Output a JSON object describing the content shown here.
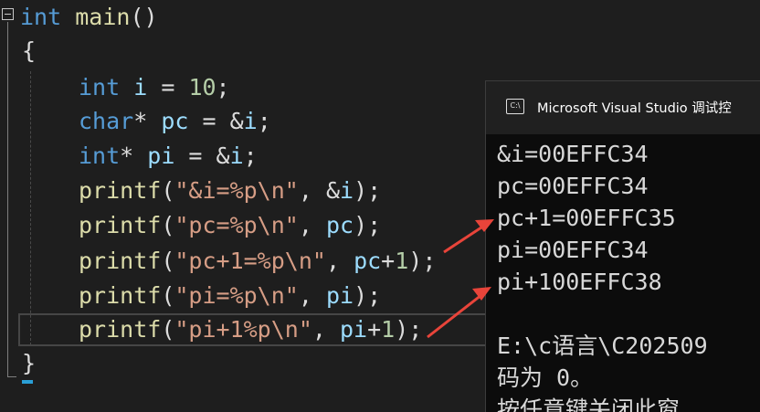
{
  "window_title": "Microsoft Visual Studio 调试控",
  "console_icon_label": "C:\\",
  "accent_color": "#e8443a",
  "code": {
    "line1": {
      "kw": "int",
      "fn": "main",
      "rest": "()"
    },
    "line2": "{",
    "line3": {
      "kw": "int",
      "var": "i",
      "op": " = ",
      "num": "10",
      "end": ";"
    },
    "line4": {
      "kw": "char",
      "mid": "* ",
      "var": "pc",
      "op": " = &",
      "var2": "i",
      "end": ";"
    },
    "line5": {
      "kw": "int",
      "mid": "* ",
      "var": "pi",
      "op": " = &",
      "var2": "i",
      "end": ";"
    },
    "line6": {
      "fn": "printf",
      "open": "(",
      "str": "\"&i=%p\\n\"",
      "sep": ", &",
      "var": "i",
      "close": ");"
    },
    "line7": {
      "fn": "printf",
      "open": "(",
      "str": "\"pc=%p\\n\"",
      "sep": ", ",
      "var": "pc",
      "close": ");"
    },
    "line8": {
      "fn": "printf",
      "open": "(",
      "str": "\"pc+1=%p\\n\"",
      "sep": ", ",
      "var": "pc",
      "plus": "+",
      "num": "1",
      "close": ");"
    },
    "line9": {
      "fn": "printf",
      "open": "(",
      "str": "\"pi=%p\\n\"",
      "sep": ", ",
      "var": "pi",
      "close": ");"
    },
    "line10": {
      "fn": "printf",
      "open": "(",
      "str": "\"pi+1%p\\n\"",
      "sep": ", ",
      "var": "pi",
      "plus": "+",
      "num": "1",
      "close": ");"
    },
    "line11": "}"
  },
  "console_lines": [
    "&i=00EFFC34",
    "pc=00EFFC34",
    "pc+1=00EFFC35",
    "pi=00EFFC34",
    "pi+100EFFC38",
    "",
    "E:\\c语言\\C202509",
    "码为 0。",
    "按任意键关闭此窗"
  ]
}
